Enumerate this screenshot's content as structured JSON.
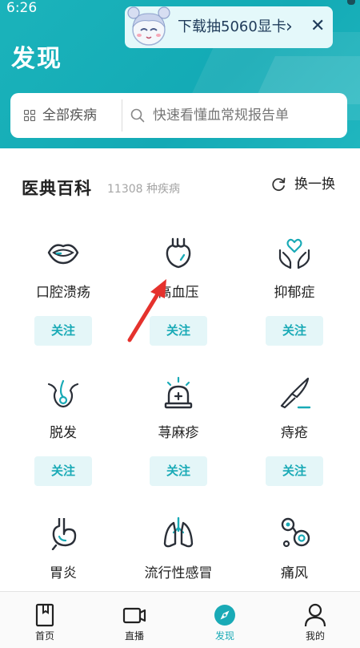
{
  "status_bar": {
    "time": "6:26"
  },
  "header": {
    "title": "发现"
  },
  "promo": {
    "text": "下载抽5060显卡",
    "arrow": "›",
    "close": "✕"
  },
  "search": {
    "category_label": "全部疾病",
    "placeholder": "快速看懂血常规报告单"
  },
  "encyclopedia": {
    "title": "医典百科",
    "count": "11308 种疾病",
    "refresh_label": "换一换",
    "follow_label": "关注",
    "items": [
      {
        "name": "口腔溃疡",
        "icon": "mouth-icon"
      },
      {
        "name": "高血压",
        "icon": "heart-icon"
      },
      {
        "name": "抑郁症",
        "icon": "hands-heart-icon"
      },
      {
        "name": "脱发",
        "icon": "hair-follicle-icon"
      },
      {
        "name": "荨麻疹",
        "icon": "alarm-light-icon"
      },
      {
        "name": "痔疮",
        "icon": "scalpel-icon"
      },
      {
        "name": "胃炎",
        "icon": "stomach-icon"
      },
      {
        "name": "流行性感冒",
        "icon": "lungs-icon"
      },
      {
        "name": "痛风",
        "icon": "joint-icon"
      }
    ]
  },
  "tabbar": {
    "items": [
      {
        "label": "首页",
        "icon": "book-icon"
      },
      {
        "label": "直播",
        "icon": "video-camera-icon"
      },
      {
        "label": "发现",
        "icon": "compass-icon"
      },
      {
        "label": "我的",
        "icon": "user-icon"
      }
    ]
  },
  "colors": {
    "accent": "#19aab6",
    "header": "#1bb3bb",
    "follow_bg": "#e4f6f8",
    "arrow": "#e5322d"
  }
}
